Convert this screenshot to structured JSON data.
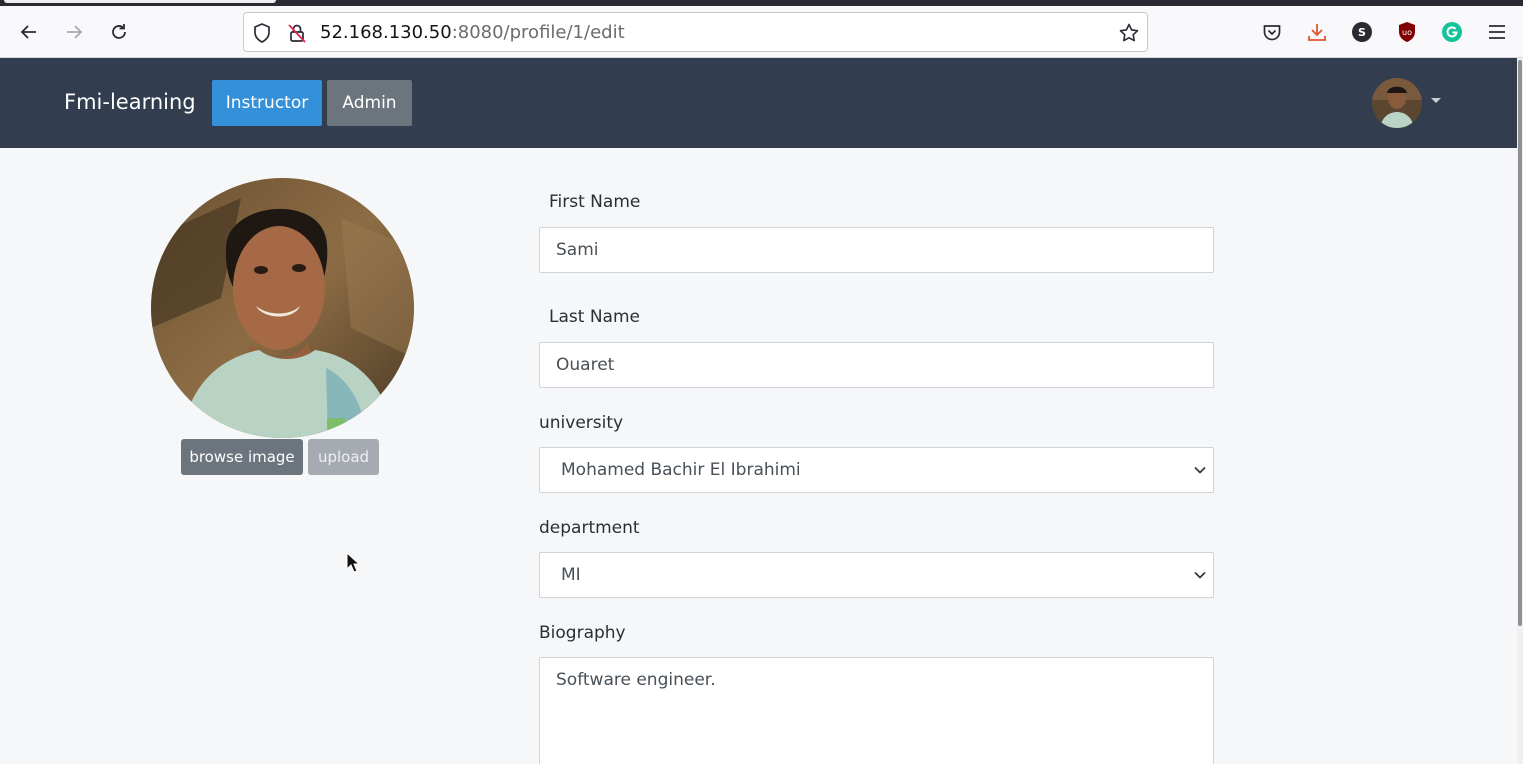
{
  "browser": {
    "url_host": "52.168.130.50",
    "url_rest": ":8080/profile/1/edit",
    "icons": [
      "back-arrow-icon",
      "forward-arrow-icon",
      "reload-icon",
      "shield-icon",
      "insecure-lock-icon",
      "bookmark-star-icon",
      "pocket-icon",
      "download-icon",
      "s-extension-icon",
      "ublock-icon",
      "grammarly-icon",
      "hamburger-menu-icon"
    ],
    "s_extension_letter": "S"
  },
  "navbar": {
    "brand": "Fmi-learning",
    "instructor_label": "Instructor",
    "admin_label": "Admin",
    "colors": {
      "background": "#323e4f",
      "instructor": "#3491d9",
      "admin": "#6c757d"
    }
  },
  "profile": {
    "browse_label": "browse image",
    "upload_label": "upload"
  },
  "form": {
    "first_name_label": "First Name",
    "first_name_value": "Sami",
    "last_name_label": "Last Name",
    "last_name_value": "Ouaret",
    "university_label": "university",
    "university_value": "Mohamed Bachir El Ibrahimi",
    "department_label": "department",
    "department_value": "MI",
    "biography_label": "Biography",
    "biography_value": "Software engineer."
  }
}
